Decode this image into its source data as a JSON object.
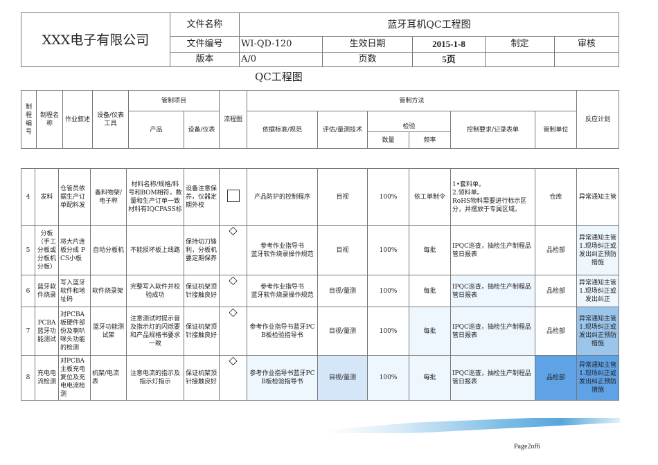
{
  "header": {
    "company": "XXX电子有限公司",
    "file_name_label": "文件名称",
    "file_name": "蓝牙耳机QC工程图",
    "file_no_label": "文件编号",
    "file_no": "WI-QD-120",
    "effective_label": "生效日期",
    "effective_date": "2015-1-8",
    "made_label": "制定",
    "review_label": "审核",
    "version_label": "版本",
    "version": "A/0",
    "pages_label": "页数",
    "pages": "5页"
  },
  "doc_title": "QC工程图",
  "columns": {
    "no": "制程编号",
    "name": "制程名称",
    "desc": "作业叙述",
    "equip": "设备/仪表 工具",
    "control_items": "管制项目",
    "product": "产品",
    "equip2": "设备/仪表",
    "flow": "流程图",
    "control_method": "管制方法",
    "standard": "依据标准/规范",
    "eval": "评估/量测技术",
    "inspect": "检验",
    "qty": "数量",
    "freq": "频率",
    "record": "控制要求/记录表单",
    "unit": "管制单位",
    "reaction": "反应计划"
  },
  "rows": [
    {
      "no": "4",
      "name": "发料",
      "desc": "仓管员依据生产订单配料发",
      "equip": "备料物架/电子秤",
      "product": "材料名称/规格/料号和BOM相符，数量和生产订单一致材料有IQCPASS标",
      "equip2": "设备注意保养，仪器定期外校",
      "flow": "square",
      "standard": "产品防护的控制程序",
      "eval": "目视",
      "qty": "100%",
      "freq": "依工单制令",
      "record": "1•套料单。\n2.领料单。\nRoHS物料需要进行标示区分，并摆放于专属区域。",
      "unit": "仓库",
      "reaction": "异常通知主管"
    },
    {
      "no": "5",
      "name": "分板（手工分板或分板机分板）",
      "desc": "将大片连板分成 PCS小板",
      "equip": "自动分板机",
      "product": "不能损坏板上线路",
      "equip2": "保持切刀锋利，分板机要定期保养",
      "flow": "diamond",
      "standard": "参考作业指导书\n蓝牙软件烧录操作规范",
      "eval": "目视",
      "qty": "100%",
      "freq": "每批",
      "record": "IPQC巡查，抽检生产制程品管日报表",
      "unit": "品检部",
      "reaction": "异常通知主管\n1.现场纠正或发出纠正预防措施"
    },
    {
      "no": "6",
      "name": "蓝牙软件烧录",
      "desc": "写入蓝牙软件和地址码",
      "equip": "软件烧录架",
      "product": "完整写入软件并校验成功",
      "equip2": "保证机架顶针接触良好",
      "flow": "diamond",
      "standard": "参考作业指导书\n蓝牙软件烧录操作规范",
      "eval": "目视/量测",
      "qty": "100%",
      "freq": "每批",
      "record": "IPQC巡查，抽检生产制程品管日报表",
      "unit": "品检部",
      "reaction": "异常通知主管\n1.现场纠正或发出纠正"
    },
    {
      "no": "7",
      "name": "PCBA蓝牙功能测试",
      "desc": "对PCBA板硬件部份及喇叭咪头功能的检测",
      "equip": "蓝牙功能测试架",
      "product": "注意测试时提示音及指示灯的闪烁要和产品规格书要求一致",
      "equip2": "保证机架顶针接触良好",
      "flow": "diamond",
      "standard": "参考作业指导书蓝牙PCB板检验指导书",
      "eval": "目视/量测",
      "qty": "100%",
      "freq": "每批",
      "record": "IPQC巡查，抽检生产制程品管日报表",
      "unit": "品检部",
      "reaction": "异常通知主管\n1.现场纠正或发出纠正预防措施"
    },
    {
      "no": "8",
      "name": "充电电流检测",
      "desc": "对PCBA主板充电复位及充电电流检测",
      "equip": "机架/电流表",
      "product": "注意电流的指示及指示灯指示",
      "equip2": "保证机架顶针接触良好",
      "flow": "diamond",
      "standard": "参考作业指导书蓝牙PCB板检验指导书",
      "eval": "目视/量测",
      "qty": "100%",
      "freq": "每批",
      "record": "IPQC巡查，抽检生产制程品管日报表",
      "unit": "品检部",
      "reaction": "异常通知主管\n1.现场纠正或发出纠正预防措施"
    }
  ],
  "footer": {
    "page": "Page2of6"
  }
}
